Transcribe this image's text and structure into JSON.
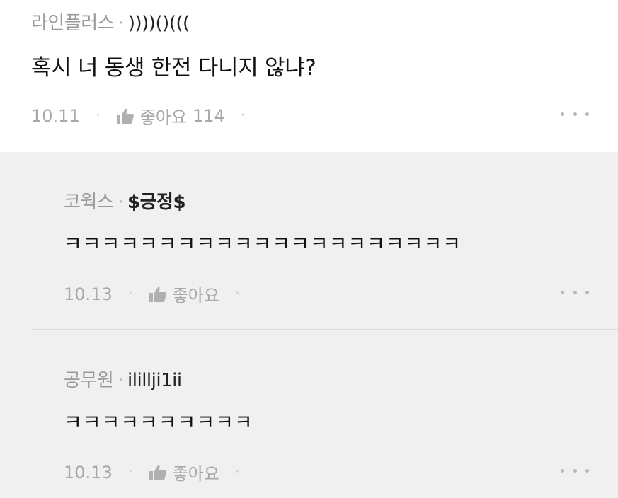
{
  "main_comment": {
    "company": "라인플러스",
    "separator": "·",
    "nickname": "))))()(((",
    "text": "혹시 너 동생 한전 다니지 않냐?",
    "date": "10.11",
    "like_label": "좋아요",
    "like_count": "114"
  },
  "replies": [
    {
      "company": "코웍스",
      "separator": "·",
      "nickname": "$긍정$",
      "text": "ㅋㅋㅋㅋㅋㅋㅋㅋㅋㅋㅋㅋㅋㅋㅋㅋㅋㅋㅋㅋㅋ",
      "date": "10.13",
      "like_label": "좋아요"
    },
    {
      "company": "공무원",
      "separator": "·",
      "nickname": "ilillji1ii",
      "text": "ㅋㅋㅋㅋㅋㅋㅋㅋㅋㅋ",
      "date": "10.13",
      "like_label": "좋아요"
    }
  ],
  "icons": {
    "like": "thumbs-up-icon",
    "more": "more-horizontal-icon"
  },
  "colors": {
    "meta_gray": "#9a9a9a",
    "text_dark": "#111111",
    "reply_bg": "#f0f0f0"
  }
}
